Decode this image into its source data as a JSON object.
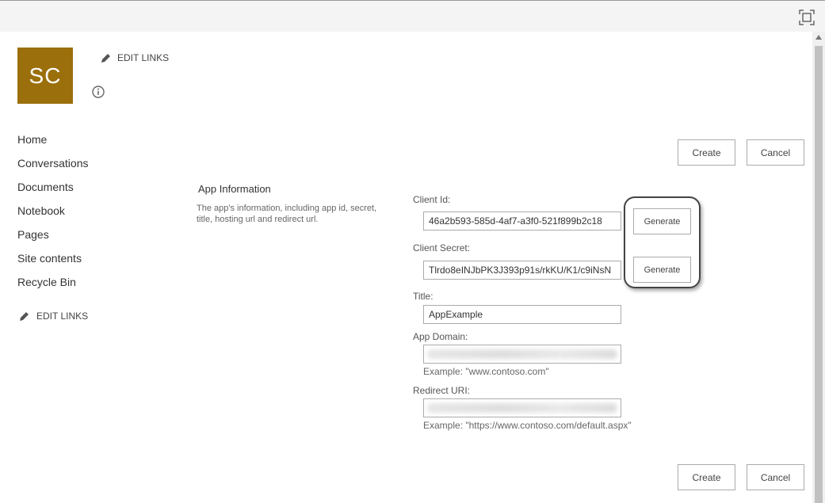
{
  "header": {
    "focus_icon": "focus-mode-icon"
  },
  "site": {
    "logo_text": "SC"
  },
  "top_links": {
    "edit_links": "EDIT LINKS"
  },
  "nav": {
    "items": [
      "Home",
      "Conversations",
      "Documents",
      "Notebook",
      "Pages",
      "Site contents",
      "Recycle Bin"
    ],
    "edit_links": "EDIT LINKS"
  },
  "actions": {
    "create": "Create",
    "cancel": "Cancel"
  },
  "app_info": {
    "title": "App Information",
    "description": "The app's information, including app id, secret, title, hosting url and redirect url."
  },
  "form": {
    "client_id": {
      "label": "Client Id:",
      "value": "46a2b593-585d-4af7-a3f0-521f899b2c18",
      "button": "Generate"
    },
    "client_secret": {
      "label": "Client Secret:",
      "value": "Tlrdo8eINJbPK3J393p91s/rkKU/K1/c9iNsN",
      "button": "Generate"
    },
    "title": {
      "label": "Title:",
      "value": "AppExample"
    },
    "app_domain": {
      "label": "App Domain:",
      "hint": "Example: \"www.contoso.com\""
    },
    "redirect_uri": {
      "label": "Redirect URI:",
      "hint": "Example: \"https://www.contoso.com/default.aspx\""
    }
  }
}
